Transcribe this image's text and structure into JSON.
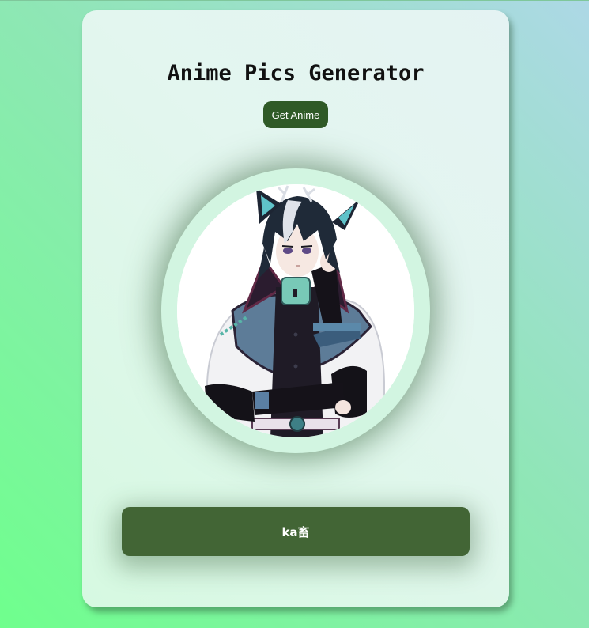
{
  "app": {
    "title": "Anime Pics Generator",
    "get_button_label": "Get Anime"
  },
  "image": {
    "subject": "anime boy with cat ears",
    "alt": "anime-character-image"
  },
  "caption": {
    "name": "ka畜"
  },
  "colors": {
    "button": "#2f5a27",
    "caption_bar": "#426535",
    "card": "#dff7ea"
  }
}
